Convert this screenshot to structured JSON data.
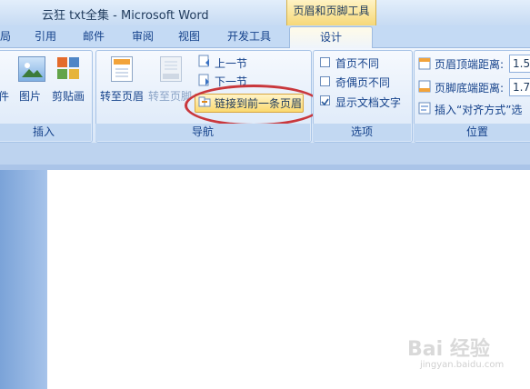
{
  "window": {
    "title": "云狂 txt全集 - Microsoft Word",
    "context_tab_title": "页眉和页脚工具"
  },
  "tabs": [
    "局",
    "引用",
    "邮件",
    "审阅",
    "视图",
    "开发工具",
    "设计"
  ],
  "ribbon": {
    "insert_group": {
      "items": [
        "件",
        "图片",
        "剪贴画"
      ],
      "label": "插入"
    },
    "nav_group": {
      "goto_header": "转至页眉",
      "goto_footer": "转至页脚",
      "prev_section": "上一节",
      "next_section": "下一节",
      "link_previous": "链接到前一条页眉",
      "label": "导航"
    },
    "options_group": {
      "different_first_page": "首页不同",
      "different_odd_even": "奇偶页不同",
      "show_doc_text": "显示文档文字",
      "show_doc_text_checked": true,
      "label": "选项"
    },
    "position_group": {
      "header_from_top_label": "页眉顶端距离:",
      "header_from_top_value": "1.5",
      "footer_from_bottom_label": "页脚底端距离:",
      "footer_from_bottom_value": "1.7",
      "insert_align_tab": "插入“对齐方式”选",
      "label": "位置"
    }
  },
  "watermark": {
    "brand": "Bai 经验",
    "url": "jingyan.baidu.com"
  }
}
